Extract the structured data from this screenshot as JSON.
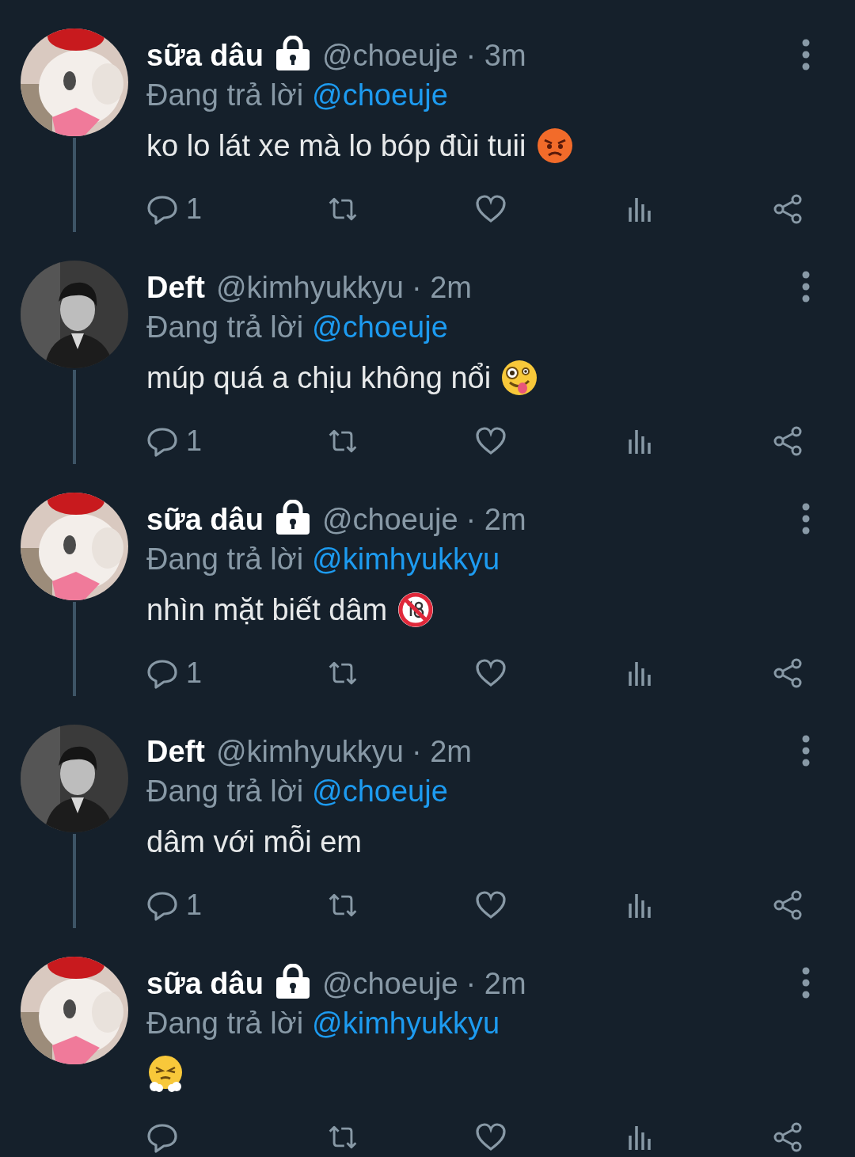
{
  "tweets": [
    {
      "name": "sữa dâu",
      "locked": true,
      "handle": "@choeuje",
      "time": "· 3m",
      "avatar": {
        "kind": "plush"
      },
      "reply_label": "Đang trả lời",
      "reply_to": "@choeuje",
      "text": "ko lo lát xe mà lo bóp đùi tuii",
      "emoji": {
        "kind": "angry"
      },
      "reply_count": "1",
      "thread_below": true
    },
    {
      "name": "Deft",
      "locked": false,
      "handle": "@kimhyukkyu",
      "time": "· 2m",
      "avatar": {
        "kind": "person"
      },
      "reply_label": "Đang trả lời",
      "reply_to": "@choeuje",
      "text": "múp quá a chịu không nổi",
      "emoji": {
        "kind": "zany"
      },
      "reply_count": "1",
      "thread_below": true
    },
    {
      "name": "sữa dâu",
      "locked": true,
      "handle": "@choeuje",
      "time": "· 2m",
      "avatar": {
        "kind": "plush"
      },
      "reply_label": "Đang trả lời",
      "reply_to": "@kimhyukkyu",
      "text": "nhìn mặt biết dâm",
      "emoji": {
        "kind": "no18"
      },
      "reply_count": "1",
      "thread_below": true
    },
    {
      "name": "Deft",
      "locked": false,
      "handle": "@kimhyukkyu",
      "time": "· 2m",
      "avatar": {
        "kind": "person"
      },
      "reply_label": "Đang trả lời",
      "reply_to": "@choeuje",
      "text": "dâm với mỗi em",
      "reply_count": "1",
      "thread_below": true
    },
    {
      "name": "sữa dâu",
      "locked": true,
      "handle": "@choeuje",
      "time": "· 2m",
      "avatar": {
        "kind": "plush"
      },
      "reply_label": "Đang trả lời",
      "reply_to": "@kimhyukkyu",
      "emoji": {
        "kind": "steam"
      },
      "thread_below": false
    }
  ]
}
